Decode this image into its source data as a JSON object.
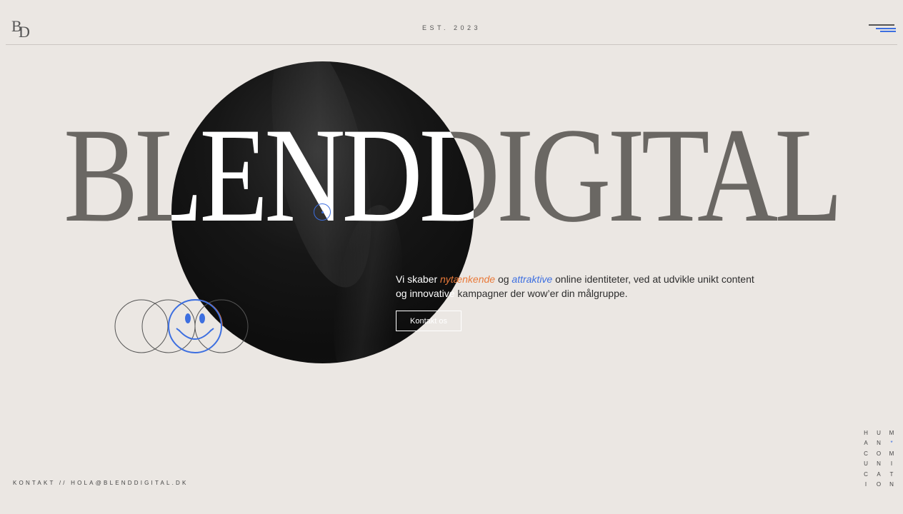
{
  "brand": {
    "logo_letters": [
      "B",
      "D"
    ],
    "established": "EST. 2023",
    "wordmark": "BLENDDIGITAL"
  },
  "header": {
    "menu_icon": "hamburger-menu-icon"
  },
  "hero": {
    "tagline": {
      "part1": "Vi skaber ",
      "accent1": "nytænkende",
      "part2": " og ",
      "accent2": "attraktive",
      "part3": " online identiteter, ved at udvikle unikt content",
      "line2a": "og innovative",
      "line2b": " kampagner der wow’er din målgruppe."
    },
    "cta_label": "Kontakt os"
  },
  "footer": {
    "contact_label": "KONTAKT // HOLA@BLENDDIGITAL.DK"
  },
  "side_text": {
    "rows": [
      [
        "H",
        "U",
        "M"
      ],
      [
        "A",
        "N",
        "*"
      ],
      [
        "C",
        "O",
        "M"
      ],
      [
        "U",
        "N",
        "I"
      ],
      [
        "C",
        "A",
        "T"
      ],
      [
        "I",
        "O",
        "N"
      ]
    ]
  },
  "colors": {
    "background": "#ebe7e3",
    "accent_orange": "#e97a3a",
    "accent_blue": "#3d6fe0",
    "wordmark_grey": "#6a6763",
    "disc": "#111111"
  },
  "icons": [
    "smiley-face-icon",
    "cursor-ring-icon"
  ]
}
